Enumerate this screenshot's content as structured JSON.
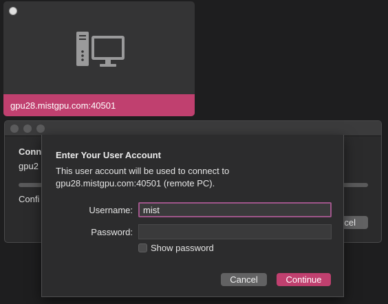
{
  "tile": {
    "host": "gpu28.mistgpu.com:40501",
    "icon": "desktop-pc-icon",
    "accent": "#c0406f"
  },
  "background_window": {
    "heading": "Conn",
    "line": "gpu2",
    "status": "Confi",
    "button": "cel"
  },
  "dialog": {
    "title": "Enter Your User Account",
    "desc_line1": "This user account will be used to connect to",
    "desc_line2": "gpu28.mistgpu.com:40501 (remote PC).",
    "username_label": "Username:",
    "username_value": "mist",
    "password_label": "Password:",
    "password_value": "",
    "show_password_label": "Show password",
    "show_password_checked": false,
    "cancel_label": "Cancel",
    "continue_label": "Continue"
  }
}
